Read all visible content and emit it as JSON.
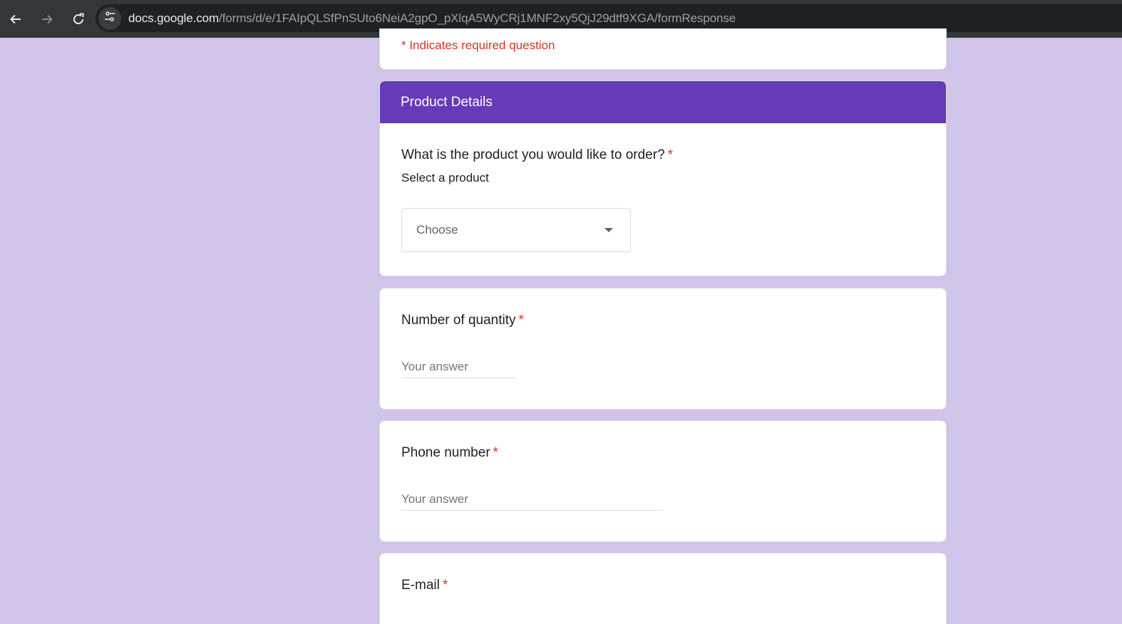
{
  "browser": {
    "url_host": "docs.google.com",
    "url_path": "/forms/d/e/1FAIpQLSfPnSUto6NeiA2gpO_pXlqA5WyCRj1MNF2xy5QjJ29dtf9XGA/formResponse"
  },
  "form": {
    "required_note": "* Indicates required question",
    "section_title": "Product Details",
    "questions": [
      {
        "title": "What is the product you would like to order?",
        "required_mark": "*",
        "description": "Select a product",
        "dropdown_value": "Choose"
      },
      {
        "title": "Number of quantity",
        "required_mark": "*",
        "placeholder": "Your answer"
      },
      {
        "title": "Phone number",
        "required_mark": "*",
        "placeholder": "Your answer"
      },
      {
        "title": "E-mail",
        "required_mark": "*"
      }
    ]
  },
  "colors": {
    "page_background": "#d1c4e9",
    "section_header": "#673ab7",
    "required": "#d93025"
  }
}
